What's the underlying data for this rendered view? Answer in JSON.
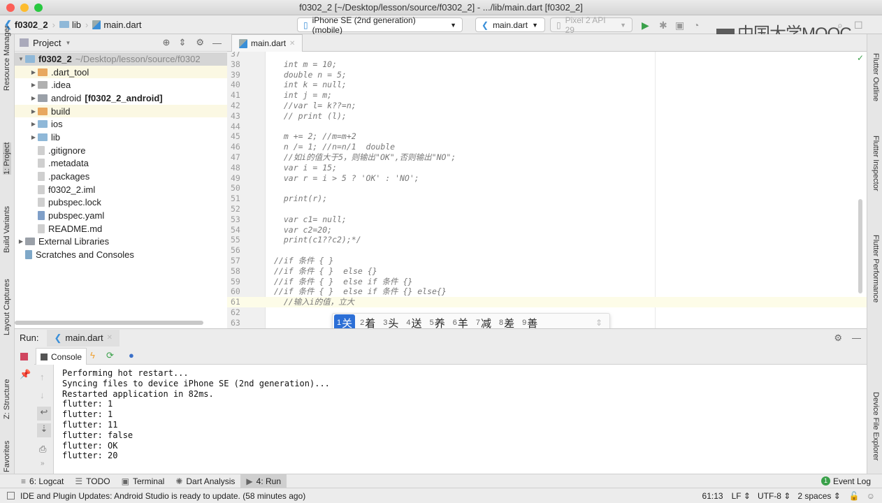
{
  "window": {
    "title": "f0302_2 [~/Desktop/lesson/source/f0302_2] - .../lib/main.dart [f0302_2]"
  },
  "navbar": {
    "breadcrumbs": [
      "f0302_2",
      "lib",
      "main.dart"
    ],
    "device_selector": "iPhone SE (2nd generation) (mobile)",
    "run_config": "main.dart",
    "emulator_selector": "Pixel 2 API 29",
    "watermark": "中国大学MOOC"
  },
  "left_strip": {
    "tabs": [
      "Resource Manager",
      "1: Project",
      "Build Variants",
      "Layout Captures",
      "Z: Structure",
      "Favorites"
    ]
  },
  "right_strip": {
    "tabs": [
      "Flutter Outline",
      "Flutter Inspector",
      "Flutter Performance",
      "Device File Explorer"
    ]
  },
  "project": {
    "title": "Project",
    "items": [
      {
        "label": "f0302_2",
        "suffix": "~/Desktop/lesson/source/f0302",
        "indent": 0,
        "arrow": "▼",
        "icon": "folder",
        "color": "#8fb8d8",
        "bold": true,
        "selected": true
      },
      {
        "label": ".dart_tool",
        "indent": 1,
        "arrow": "▶",
        "icon": "folder",
        "color": "#e8a860",
        "highlight": true
      },
      {
        "label": ".idea",
        "indent": 1,
        "arrow": "▶",
        "icon": "folder",
        "color": "#b0b0b0"
      },
      {
        "label": "android",
        "suffix": "[f0302_2_android]",
        "indent": 1,
        "arrow": "▶",
        "icon": "folder",
        "color": "#9aa0a8"
      },
      {
        "label": "build",
        "indent": 1,
        "arrow": "▶",
        "icon": "folder",
        "color": "#e8a860",
        "highlight": true
      },
      {
        "label": "ios",
        "indent": 1,
        "arrow": "▶",
        "icon": "folder",
        "color": "#8fb8d8"
      },
      {
        "label": "lib",
        "indent": 1,
        "arrow": "▶",
        "icon": "folder",
        "color": "#8fb8d8"
      },
      {
        "label": ".gitignore",
        "indent": 1,
        "arrow": "",
        "icon": "file",
        "color": "#cfcfcf"
      },
      {
        "label": ".metadata",
        "indent": 1,
        "arrow": "",
        "icon": "file",
        "color": "#cfcfcf"
      },
      {
        "label": ".packages",
        "indent": 1,
        "arrow": "",
        "icon": "file",
        "color": "#cfcfcf"
      },
      {
        "label": "f0302_2.iml",
        "indent": 1,
        "arrow": "",
        "icon": "file",
        "color": "#cfcfcf"
      },
      {
        "label": "pubspec.lock",
        "indent": 1,
        "arrow": "",
        "icon": "file",
        "color": "#cfcfcf"
      },
      {
        "label": "pubspec.yaml",
        "indent": 1,
        "arrow": "",
        "icon": "yaml-file",
        "color": "#7f9fc8"
      },
      {
        "label": "README.md",
        "indent": 1,
        "arrow": "",
        "icon": "file",
        "color": "#cfcfcf"
      },
      {
        "label": "External Libraries",
        "indent": 0,
        "arrow": "▶",
        "icon": "library",
        "color": "#9aa0a8"
      },
      {
        "label": "Scratches and Consoles",
        "indent": 0,
        "arrow": "",
        "icon": "scratches",
        "color": "#7fa8c8"
      }
    ]
  },
  "editor": {
    "tab": "main.dart",
    "current_line": 61,
    "lines": [
      {
        "n": "37",
        "code": ""
      },
      {
        "n": "38",
        "code": "  int m = 10;"
      },
      {
        "n": "39",
        "code": "  double n = 5;"
      },
      {
        "n": "40",
        "code": "  int k = null;"
      },
      {
        "n": "41",
        "code": "  int j = m;"
      },
      {
        "n": "42",
        "code": "  //var l= k??=n;"
      },
      {
        "n": "43",
        "code": "  // print (l);"
      },
      {
        "n": "44",
        "code": ""
      },
      {
        "n": "45",
        "code": "  m += 2; //m=m+2"
      },
      {
        "n": "46",
        "code": "  n /= 1; //n=n/1  double"
      },
      {
        "n": "47",
        "code": "  //如i的值大于5，则输出\"OK\",否则输出\"NO\";"
      },
      {
        "n": "48",
        "code": "  var i = 15;"
      },
      {
        "n": "49",
        "code": "  var r = i > 5 ? 'OK' : 'NO';"
      },
      {
        "n": "50",
        "code": ""
      },
      {
        "n": "51",
        "code": "  print(r);"
      },
      {
        "n": "52",
        "code": ""
      },
      {
        "n": "53",
        "code": "  var c1= null;"
      },
      {
        "n": "54",
        "code": "  var c2=20;"
      },
      {
        "n": "55",
        "code": "  print(c1??c2);*/"
      },
      {
        "n": "56",
        "code": ""
      },
      {
        "n": "57",
        "code": "//if 条件 { }"
      },
      {
        "n": "58",
        "code": "//if 条件 { }  else {}"
      },
      {
        "n": "59",
        "code": "//if 条件 { }  else if 条件 {}"
      },
      {
        "n": "60",
        "code": "//if 条件 { }  else if 条件 {} else{}"
      },
      {
        "n": "61",
        "code": "  //输入i的值，立大"
      },
      {
        "n": "62",
        "code": ""
      },
      {
        "n": "63",
        "code": ""
      }
    ]
  },
  "ime": {
    "candidates": [
      {
        "n": "1",
        "c": "关"
      },
      {
        "n": "2",
        "c": "着"
      },
      {
        "n": "3",
        "c": "头"
      },
      {
        "n": "4",
        "c": "送"
      },
      {
        "n": "5",
        "c": "养"
      },
      {
        "n": "6",
        "c": "羊"
      },
      {
        "n": "7",
        "c": "减"
      },
      {
        "n": "8",
        "c": "差"
      },
      {
        "n": "9",
        "c": "善"
      }
    ],
    "selected": 0
  },
  "run": {
    "label": "Run:",
    "tab": "main.dart",
    "console_tab": "Console",
    "output": [
      "Performing hot restart...",
      "Syncing files to device iPhone SE (2nd generation)...",
      "Restarted application in 82ms.",
      "flutter: 1",
      "flutter: 1",
      "flutter: 11",
      "flutter: false",
      "flutter: OK",
      "flutter: 20"
    ]
  },
  "bottom_tabs": [
    {
      "label": "6: Logcat",
      "icon": "logcat-icon"
    },
    {
      "label": "TODO",
      "icon": "todo-icon"
    },
    {
      "label": "Terminal",
      "icon": "terminal-icon"
    },
    {
      "label": "Dart Analysis",
      "icon": "dart-analysis-icon"
    },
    {
      "label": "4: Run",
      "icon": "run-icon",
      "selected": true
    }
  ],
  "event_log": {
    "label": "Event Log",
    "count": "1"
  },
  "status": {
    "message": "IDE and Plugin Updates: Android Studio is ready to update. (58 minutes ago)",
    "position": "61:13",
    "line_sep": "LF",
    "encoding": "UTF-8",
    "indent": "2 spaces"
  }
}
